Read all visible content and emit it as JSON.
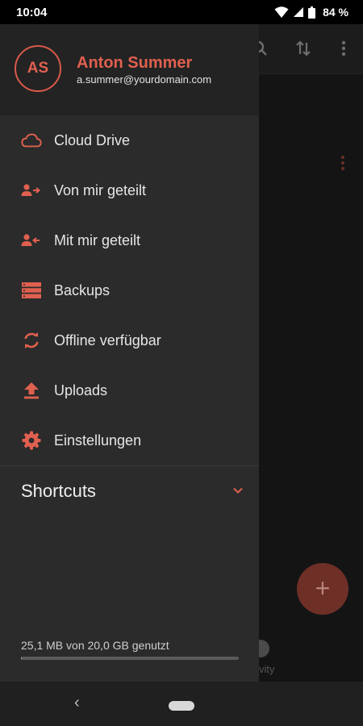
{
  "status_bar": {
    "time": "10:04",
    "battery": "84 %"
  },
  "user": {
    "initials": "AS",
    "name": "Anton Summer",
    "email": "a.summer@yourdomain.com"
  },
  "menu": [
    {
      "label": "Cloud Drive",
      "icon": "cloud-icon"
    },
    {
      "label": "Von mir geteilt",
      "icon": "shared-outgoing-icon"
    },
    {
      "label": "Mit mir geteilt",
      "icon": "shared-incoming-icon"
    },
    {
      "label": "Backups",
      "icon": "backups-icon"
    },
    {
      "label": "Offline verfügbar",
      "icon": "sync-icon"
    },
    {
      "label": "Uploads",
      "icon": "upload-icon"
    },
    {
      "label": "Einstellungen",
      "icon": "gear-icon"
    }
  ],
  "shortcuts": {
    "label": "Shortcuts"
  },
  "storage": {
    "text": "25,1 MB von 20,0 GB genutzt",
    "used_fraction": 0.0013
  },
  "background": {
    "fab_label": "+",
    "tab_label": "vity"
  },
  "colors": {
    "accent": "#e0604f",
    "drawer_bg": "#2b2b2b",
    "header_bg": "#232323"
  }
}
